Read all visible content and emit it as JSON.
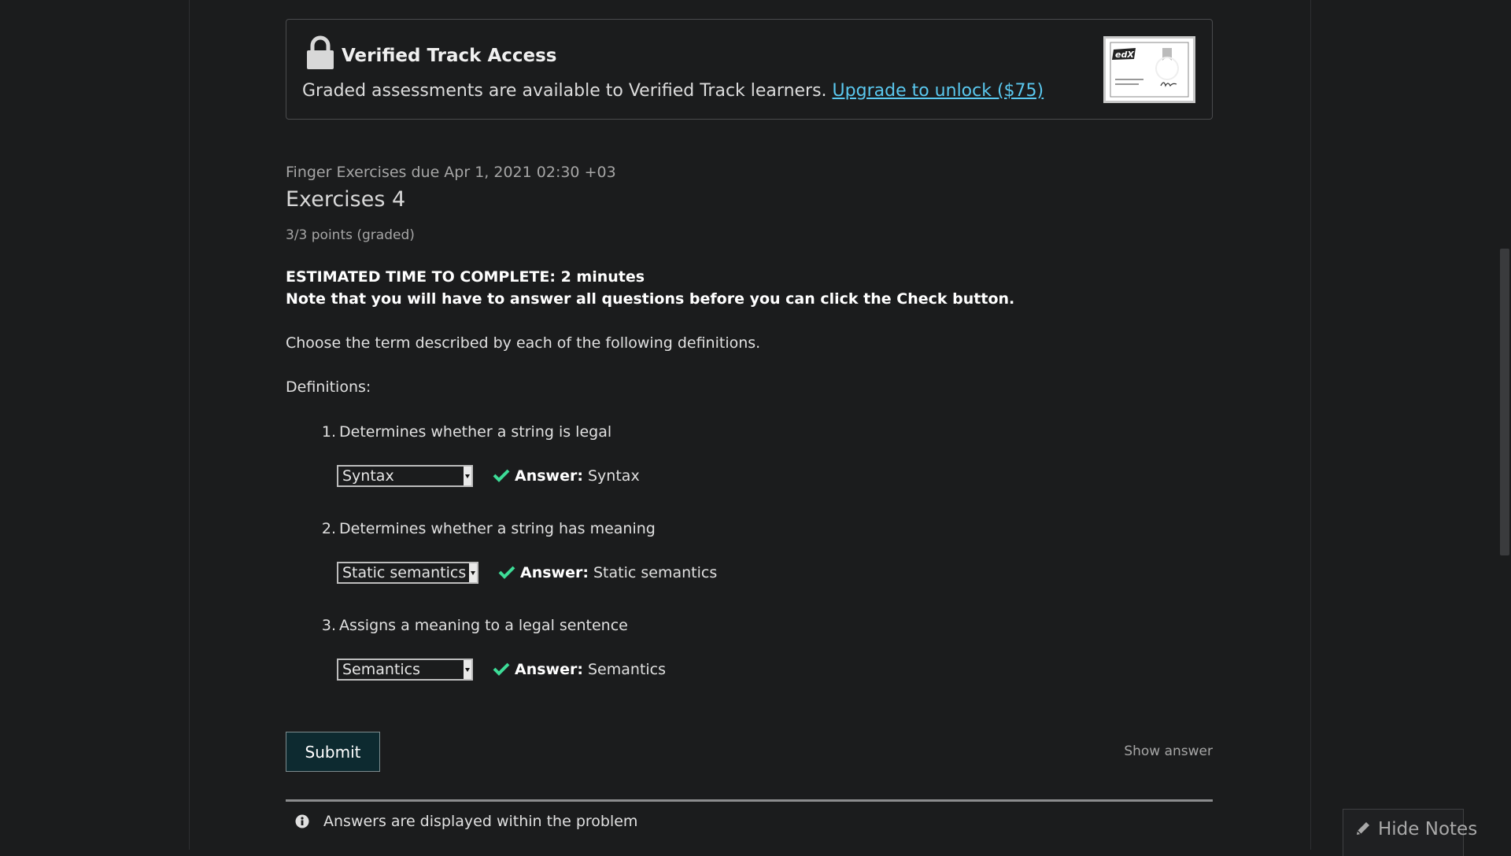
{
  "banner": {
    "title": "Verified Track Access",
    "text": "Graded assessments are available to Verified Track learners.",
    "link": "Upgrade to unlock ($75)",
    "icon": "lock-icon",
    "certificate_logo": "edX"
  },
  "problem": {
    "due": "Finger Exercises due Apr 1, 2021 02:30 +03",
    "title": "Exercises 4",
    "points": "3/3 points (graded)",
    "estimated": "ESTIMATED TIME TO COMPLETE: 2 minutes",
    "note": "Note that you will have to answer all questions before you can click the Check button.",
    "instructions": "Choose the term described by each of the following definitions.",
    "definitions_label": "Definitions:",
    "questions": [
      {
        "num": "1.",
        "text": "Determines whether a string is legal",
        "selected": "Syntax",
        "answer_label": "Answer:",
        "answer": "Syntax"
      },
      {
        "num": "2.",
        "text": "Determines whether a string has meaning",
        "selected": "Static semantics",
        "answer_label": "Answer:",
        "answer": "Static semantics"
      },
      {
        "num": "3.",
        "text": "Assigns a meaning to a legal sentence",
        "selected": "Semantics",
        "answer_label": "Answer:",
        "answer": "Semantics"
      }
    ],
    "submit": "Submit",
    "show_answer": "Show answer",
    "info": "Answers are displayed within the problem"
  },
  "notes": {
    "hide_label": "Hide Notes"
  },
  "colors": {
    "background": "#1b1c1d",
    "link": "#5ac8ef",
    "check": "#3ddc97",
    "submit_bg": "#0d2a30"
  }
}
